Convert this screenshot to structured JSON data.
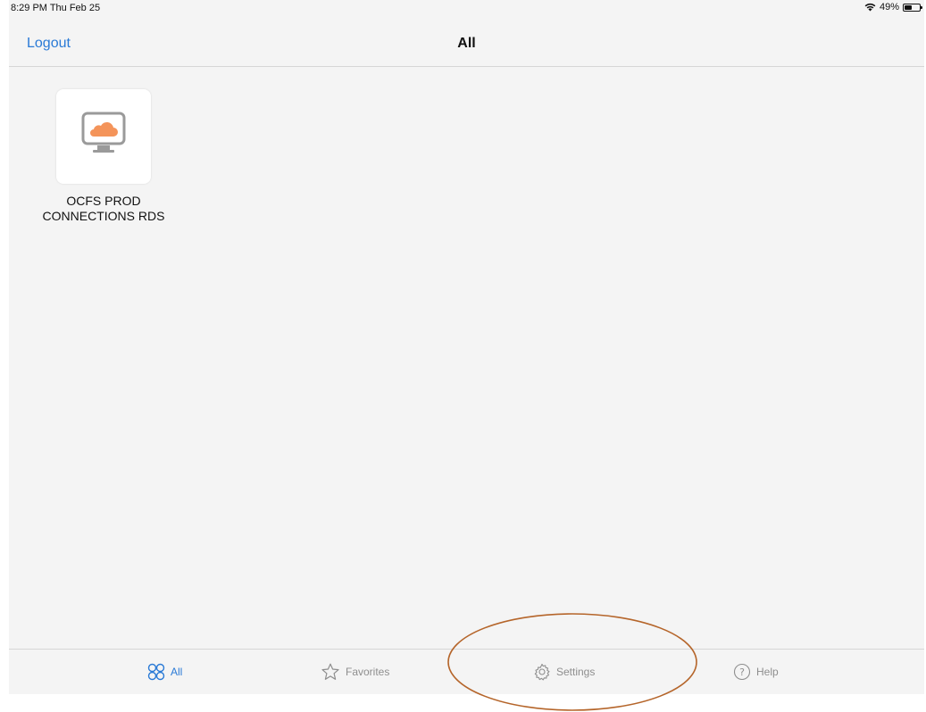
{
  "status_bar": {
    "time": "8:29 PM  Thu Feb 25",
    "battery_text": "49%",
    "battery_level": 0.49,
    "wifi_icon": "wifi-icon",
    "battery_icon": "battery-icon"
  },
  "nav": {
    "logout_label": "Logout",
    "title": "All"
  },
  "apps": [
    {
      "label": "OCFS PROD CONNECTIONS RDS",
      "label_line1": "OCFS PROD",
      "label_line2": "CONNECTIONS RDS",
      "icon": "desktop-cloud-icon",
      "icon_color": "#f4945a"
    }
  ],
  "tab_bar": {
    "tabs": [
      {
        "label": "All",
        "icon": "grid-circles-icon",
        "active": true
      },
      {
        "label": "Favorites",
        "icon": "star-icon",
        "active": false
      },
      {
        "label": "Settings",
        "icon": "gear-icon",
        "active": false
      },
      {
        "label": "Help",
        "icon": "help-circle-icon",
        "active": false
      }
    ]
  },
  "colors": {
    "accent": "#2a7ad6",
    "background": "#f4f4f4",
    "annotation": "#b5652a"
  }
}
